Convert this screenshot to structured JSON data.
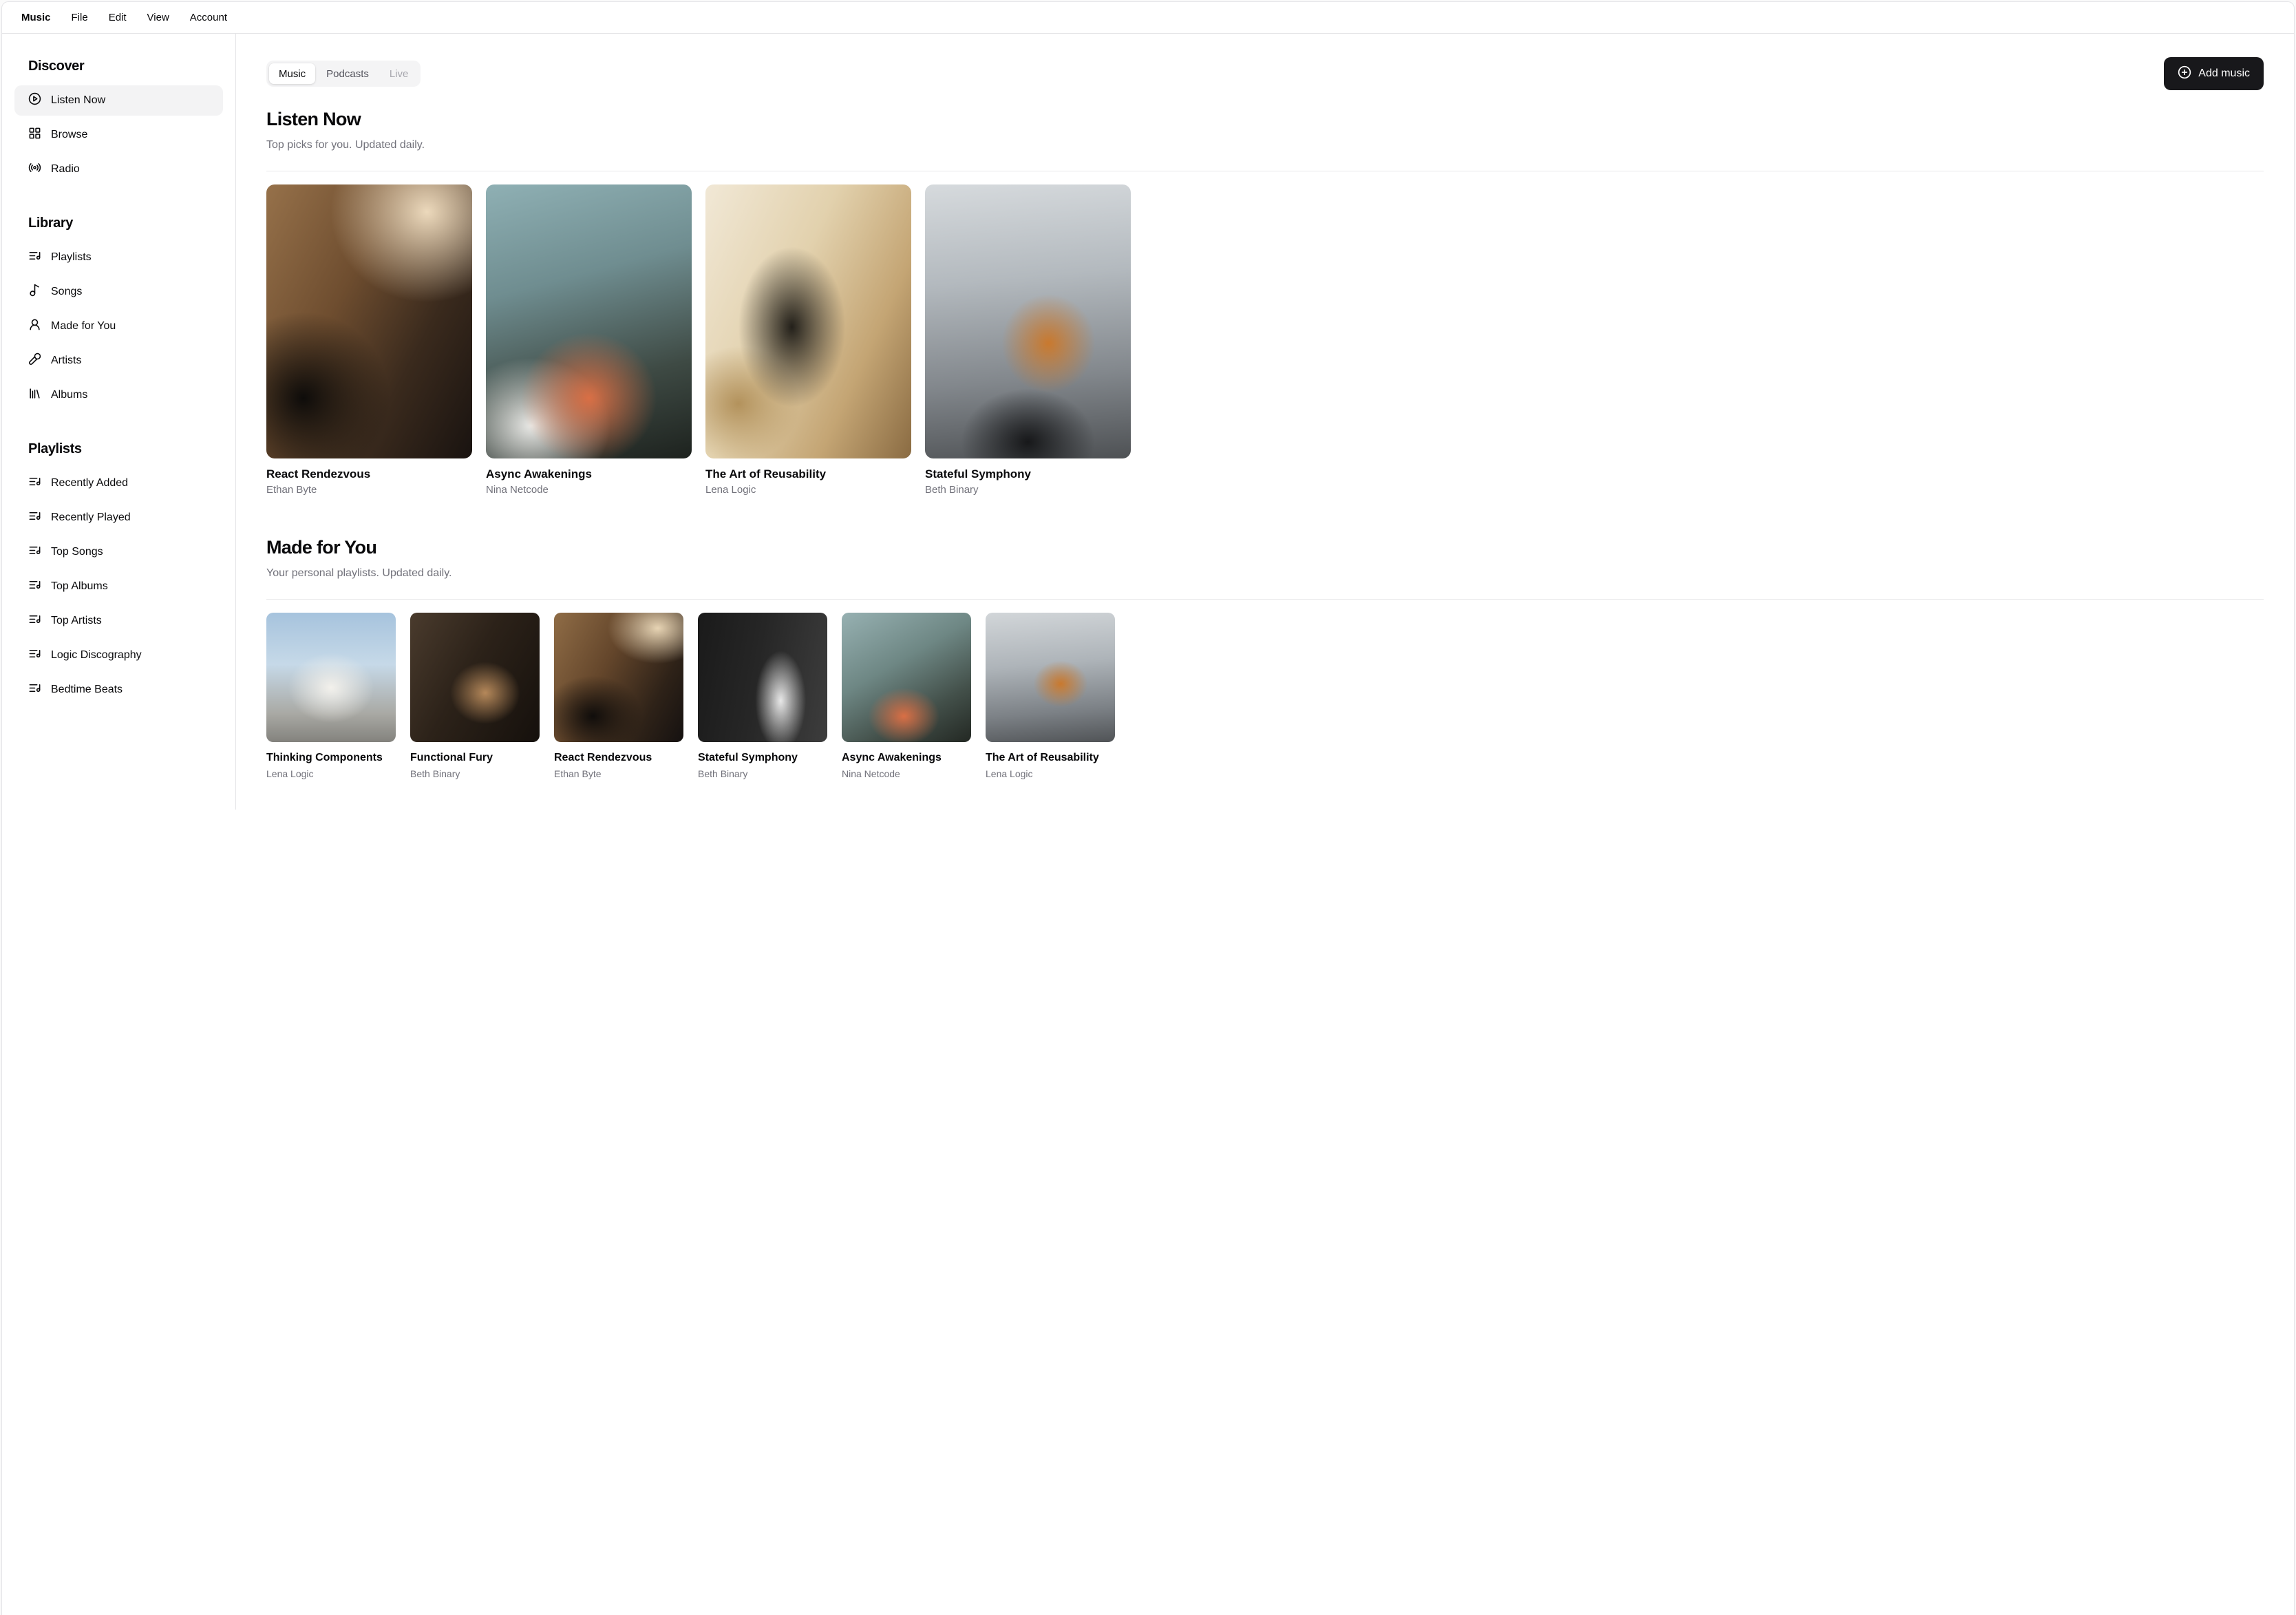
{
  "menubar": {
    "items": [
      "Music",
      "File",
      "Edit",
      "View",
      "Account"
    ]
  },
  "colors": {
    "border": "#e4e4e7",
    "muted_text": "#71717a",
    "active_pill_bg": "#f3f3f4",
    "tab_list_bg": "#f4f4f5",
    "primary_button_bg": "#18181b",
    "primary_button_text": "#ffffff"
  },
  "sidebar": {
    "sections": [
      {
        "title": "Discover",
        "items": [
          {
            "label": "Listen Now",
            "icon": "circle-play",
            "active": true
          },
          {
            "label": "Browse",
            "icon": "layout-grid",
            "active": false
          },
          {
            "label": "Radio",
            "icon": "radio",
            "active": false
          }
        ]
      },
      {
        "title": "Library",
        "items": [
          {
            "label": "Playlists",
            "icon": "list-music",
            "active": false
          },
          {
            "label": "Songs",
            "icon": "music-note",
            "active": false
          },
          {
            "label": "Made for You",
            "icon": "user-round",
            "active": false
          },
          {
            "label": "Artists",
            "icon": "mic",
            "active": false
          },
          {
            "label": "Albums",
            "icon": "library",
            "active": false
          }
        ]
      },
      {
        "title": "Playlists",
        "items": [
          {
            "label": "Recently Added",
            "icon": "list-music",
            "active": false
          },
          {
            "label": "Recently Played",
            "icon": "list-music",
            "active": false
          },
          {
            "label": "Top Songs",
            "icon": "list-music",
            "active": false
          },
          {
            "label": "Top Albums",
            "icon": "list-music",
            "active": false
          },
          {
            "label": "Top Artists",
            "icon": "list-music",
            "active": false
          },
          {
            "label": "Logic Discography",
            "icon": "list-music",
            "active": false
          },
          {
            "label": "Bedtime Beats",
            "icon": "list-music",
            "active": false
          }
        ]
      }
    ]
  },
  "content": {
    "tabs": [
      {
        "label": "Music",
        "state": "active"
      },
      {
        "label": "Podcasts",
        "state": "default"
      },
      {
        "label": "Live",
        "state": "disabled"
      }
    ],
    "add_button": {
      "label": "Add music",
      "icon": "circle-plus"
    },
    "listen_now": {
      "title": "Listen Now",
      "subtitle": "Top picks for you. Updated daily.",
      "albums": [
        {
          "title": "React Rendezvous",
          "artist": "Ethan Byte",
          "art": "background: radial-gradient(85% 60% at 78% 10%, #ecd9bc 0%, rgba(236,217,188,0) 55%), radial-gradient(60% 45% at 18% 78%, #0e0c0a 0%, rgba(14,12,10,0) 70%), linear-gradient(118deg, #96714a 0%, #6e4d2f 38%, #3a2a1d 68%, #191310 100%)"
        },
        {
          "title": "Async Awakenings",
          "artist": "Nina Netcode",
          "art": "background: radial-gradient(55% 40% at 50% 78%, #d96f45 0%, rgba(217,111,69,0) 60%), radial-gradient(70% 45% at 22% 88%, #e9e9e6 0%, rgba(233,233,230,0) 55%), linear-gradient(165deg, #8fb0b4 0%, #6f8d90 35%, #3e4a44 70%, #1d221e 100%)"
        },
        {
          "title": "The Art of Reusability",
          "artist": "Lena Logic",
          "art": "background: radial-gradient(40% 45% at 42% 52%, #23201a 0%, rgba(35,32,26,0) 65%), radial-gradient(50% 35% at 16% 80%, #b3925c 0%, rgba(179,146,92,0) 60%), linear-gradient(115deg, #f1e8d6 0%, #e2d1ad 40%, #c4a574 72%, #8a6b42 100%)"
        },
        {
          "title": "Stateful Symphony",
          "artist": "Beth Binary",
          "art": "background: radial-gradient(38% 30% at 60% 58%, #c9792e 0%, rgba(201,121,46,0) 60%), radial-gradient(50% 30% at 50% 94%, #17181a 0%, rgba(23,24,26,0) 65%), linear-gradient(175deg, #d6dadd 0%, #b3b9be 35%, #82878c 70%, #4e5154 100%)"
        }
      ]
    },
    "made_for_you": {
      "title": "Made for You",
      "subtitle": "Your personal playlists. Updated daily.",
      "albums": [
        {
          "title": "Thinking Components",
          "artist": "Lena Logic",
          "art": "background: radial-gradient(55% 45% at 50% 58%, #f3f1ec 0%, rgba(243,241,236,0) 60%), linear-gradient(180deg, #a6c3dd 0%, #c6d9e8 40%, #a9a9a4 78%, #83827d 100%)"
        },
        {
          "title": "Functional Fury",
          "artist": "Beth Binary",
          "art": "background: radial-gradient(45% 40% at 58% 62%, #b5885a 0%, rgba(181,136,90,0) 60%), linear-gradient(120deg, #4a3b2d 0%, #2c2219 45%, #15100c 100%)"
        },
        {
          "title": "React Rendezvous",
          "artist": "Ethan Byte",
          "art": "background: radial-gradient(70% 50% at 80% 12%, #e7d4b4 0%, rgba(231,212,180,0) 55%), radial-gradient(55% 45% at 30% 80%, #100d0b 0%, rgba(16,13,11,0) 70%), linear-gradient(118deg, #8f6c46 0%, #64462b 40%, #2e2218 75%, #151110 100%)"
        },
        {
          "title": "Stateful Symphony",
          "artist": "Beth Binary",
          "art": "background: radial-gradient(28% 55% at 64% 68%, #e8e8e8 0%, rgba(232,232,232,0) 70%), linear-gradient(100deg, #1a1a1a 0%, #262626 45%, #3d3d3d 100%)"
        },
        {
          "title": "Async Awakenings",
          "artist": "Nina Netcode",
          "art": "background: radial-gradient(50% 40% at 48% 80%, #d96f45 0%, rgba(217,111,69,0) 55%), linear-gradient(150deg, #97b1b2 0%, #6e8784 40%, #43504a 72%, #232823 100%)"
        },
        {
          "title": "The Art of Reusability",
          "artist": "Lena Logic",
          "art": "background: radial-gradient(35% 30% at 58% 55%, #c9792e 0%, rgba(201,121,46,0) 60%), linear-gradient(175deg, #d2d6d9 0%, #aeb4b9 40%, #7c8186 75%, #505356 100%)"
        }
      ]
    }
  }
}
